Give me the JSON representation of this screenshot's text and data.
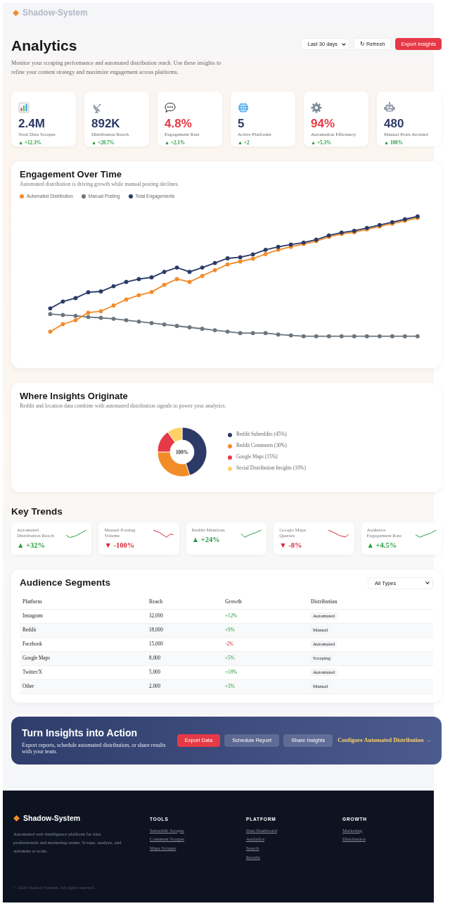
{
  "nav": {
    "brand": "Shadow-System"
  },
  "header": {
    "title": "Analytics",
    "description": "Monitor your scraping performance and automated distribution reach. Use these insights to refine your content strategy and maximize engagement across platforms.",
    "range_select": "Last 30 days",
    "buttons": [
      {
        "label": "↻ Refresh",
        "kind": "light"
      },
      {
        "label": "Export Insights",
        "kind": "primary"
      }
    ]
  },
  "stats": [
    {
      "value": "2.4M",
      "label": "Total Data Scrapes",
      "change": "▲ +12.3%",
      "color": "#2b3a67"
    },
    {
      "value": "892K",
      "label": "Distribution Reach",
      "change": "▲ +28.7%",
      "color": "#2b3a67"
    },
    {
      "value": "4.8%",
      "label": "Engagement Rate",
      "change": "▲ +2.1%",
      "color": "#e63946"
    },
    {
      "value": "5",
      "label": "Active Platforms",
      "change": "▲ +2",
      "color": "#2b3a67"
    },
    {
      "value": "94%",
      "label": "Automation Efficiency",
      "change": "▲ +5.3%",
      "color": "#e63946"
    },
    {
      "value": "480",
      "label": "Manual Posts Avoided",
      "change": "▲ 100%",
      "color": "#2b3a67"
    }
  ],
  "engagement": {
    "title": "Engagement Over Time",
    "subtitle": "Automated distribution is driving growth while manual posting declines.",
    "legend": [
      {
        "label": "Automated Distribution",
        "color": "#f28c28"
      },
      {
        "label": "Manual Posting",
        "color": "#6c757d"
      },
      {
        "label": "Total Engagements",
        "color": "#2b3a67"
      }
    ]
  },
  "sources": {
    "title": "Where Insights Originate",
    "subtitle": "Reddit and location data combine with automated distribution signals to power your analytics.",
    "chart_data": {
      "type": "donut",
      "values": [
        45,
        30,
        15,
        10
      ]
    },
    "center_label": "100%",
    "legend": [
      {
        "label": "Reddit Subreddits (45%)",
        "color": "#2b3a67"
      },
      {
        "label": "Reddit Comments (30%)",
        "color": "#f28c28"
      },
      {
        "label": "Google Maps (15%)",
        "color": "#e63946"
      },
      {
        "label": "Social Distribution Insights (10%)",
        "color": "#ffd166"
      }
    ]
  },
  "key_trends": {
    "title": "Key Trends",
    "items": [
      {
        "label": "Automated Distribution Reach",
        "value": "▲ +32%",
        "positive": true
      },
      {
        "label": "Manual Posting Volume",
        "value": "▼ -100%",
        "positive": false
      },
      {
        "label": "Reddit Mentions",
        "value": "▲ +24%",
        "positive": true
      },
      {
        "label": "Google Maps Queries",
        "value": "▼ -8%",
        "positive": false
      },
      {
        "label": "Audience Engagement Rate",
        "value": "▲ +4.5%",
        "positive": true
      }
    ]
  },
  "segments": {
    "title": "Audience Segments",
    "filter": "All Types",
    "columns": [
      "Platform",
      "Reach",
      "Growth",
      "Distribution"
    ],
    "rows": [
      {
        "platform": "Instagram",
        "reach": "32,000",
        "growth": "+12%",
        "positive": true,
        "distribution": "Automated"
      },
      {
        "platform": "Reddit",
        "reach": "18,000",
        "growth": "+9%",
        "positive": true,
        "distribution": "Manual"
      },
      {
        "platform": "Facebook",
        "reach": "15,000",
        "growth": "-2%",
        "positive": false,
        "distribution": "Automated"
      },
      {
        "platform": "Google Maps",
        "reach": "8,000",
        "growth": "+5%",
        "positive": true,
        "distribution": "Scraping"
      },
      {
        "platform": "Twitter/X",
        "reach": "5,000",
        "growth": "+18%",
        "positive": true,
        "distribution": "Automated"
      },
      {
        "platform": "Other",
        "reach": "2,000",
        "growth": "+3%",
        "positive": true,
        "distribution": "Manual"
      }
    ]
  },
  "cta": {
    "title": "Turn Insights into Action",
    "text": "Export reports, schedule automated distribution, or share results with your team.",
    "buttons": [
      {
        "label": "Export Data",
        "kind": "primary"
      },
      {
        "label": "Schedule Report",
        "kind": "ghost"
      },
      {
        "label": "Share Insights",
        "kind": "ghost"
      }
    ],
    "link": "Configure Automated Distribution →"
  },
  "footer": {
    "brand": "Shadow-System",
    "description": "Automated web intelligence platform for data professionals and marketing teams. Scrape, analyze, and automate at scale.",
    "columns": [
      {
        "heading": "TOOLS",
        "links": [
          "Subreddit Scraper",
          "Comment Scraper",
          "Maps Scraper"
        ]
      },
      {
        "heading": "PLATFORM",
        "links": [
          "Data Dashboard",
          "Analytics",
          "Search",
          "Results"
        ]
      },
      {
        "heading": "GROWTH",
        "links": [
          "Marketing",
          "Distribution"
        ]
      }
    ],
    "copyright": "© 2024 Shadow-System. All rights reserved."
  }
}
